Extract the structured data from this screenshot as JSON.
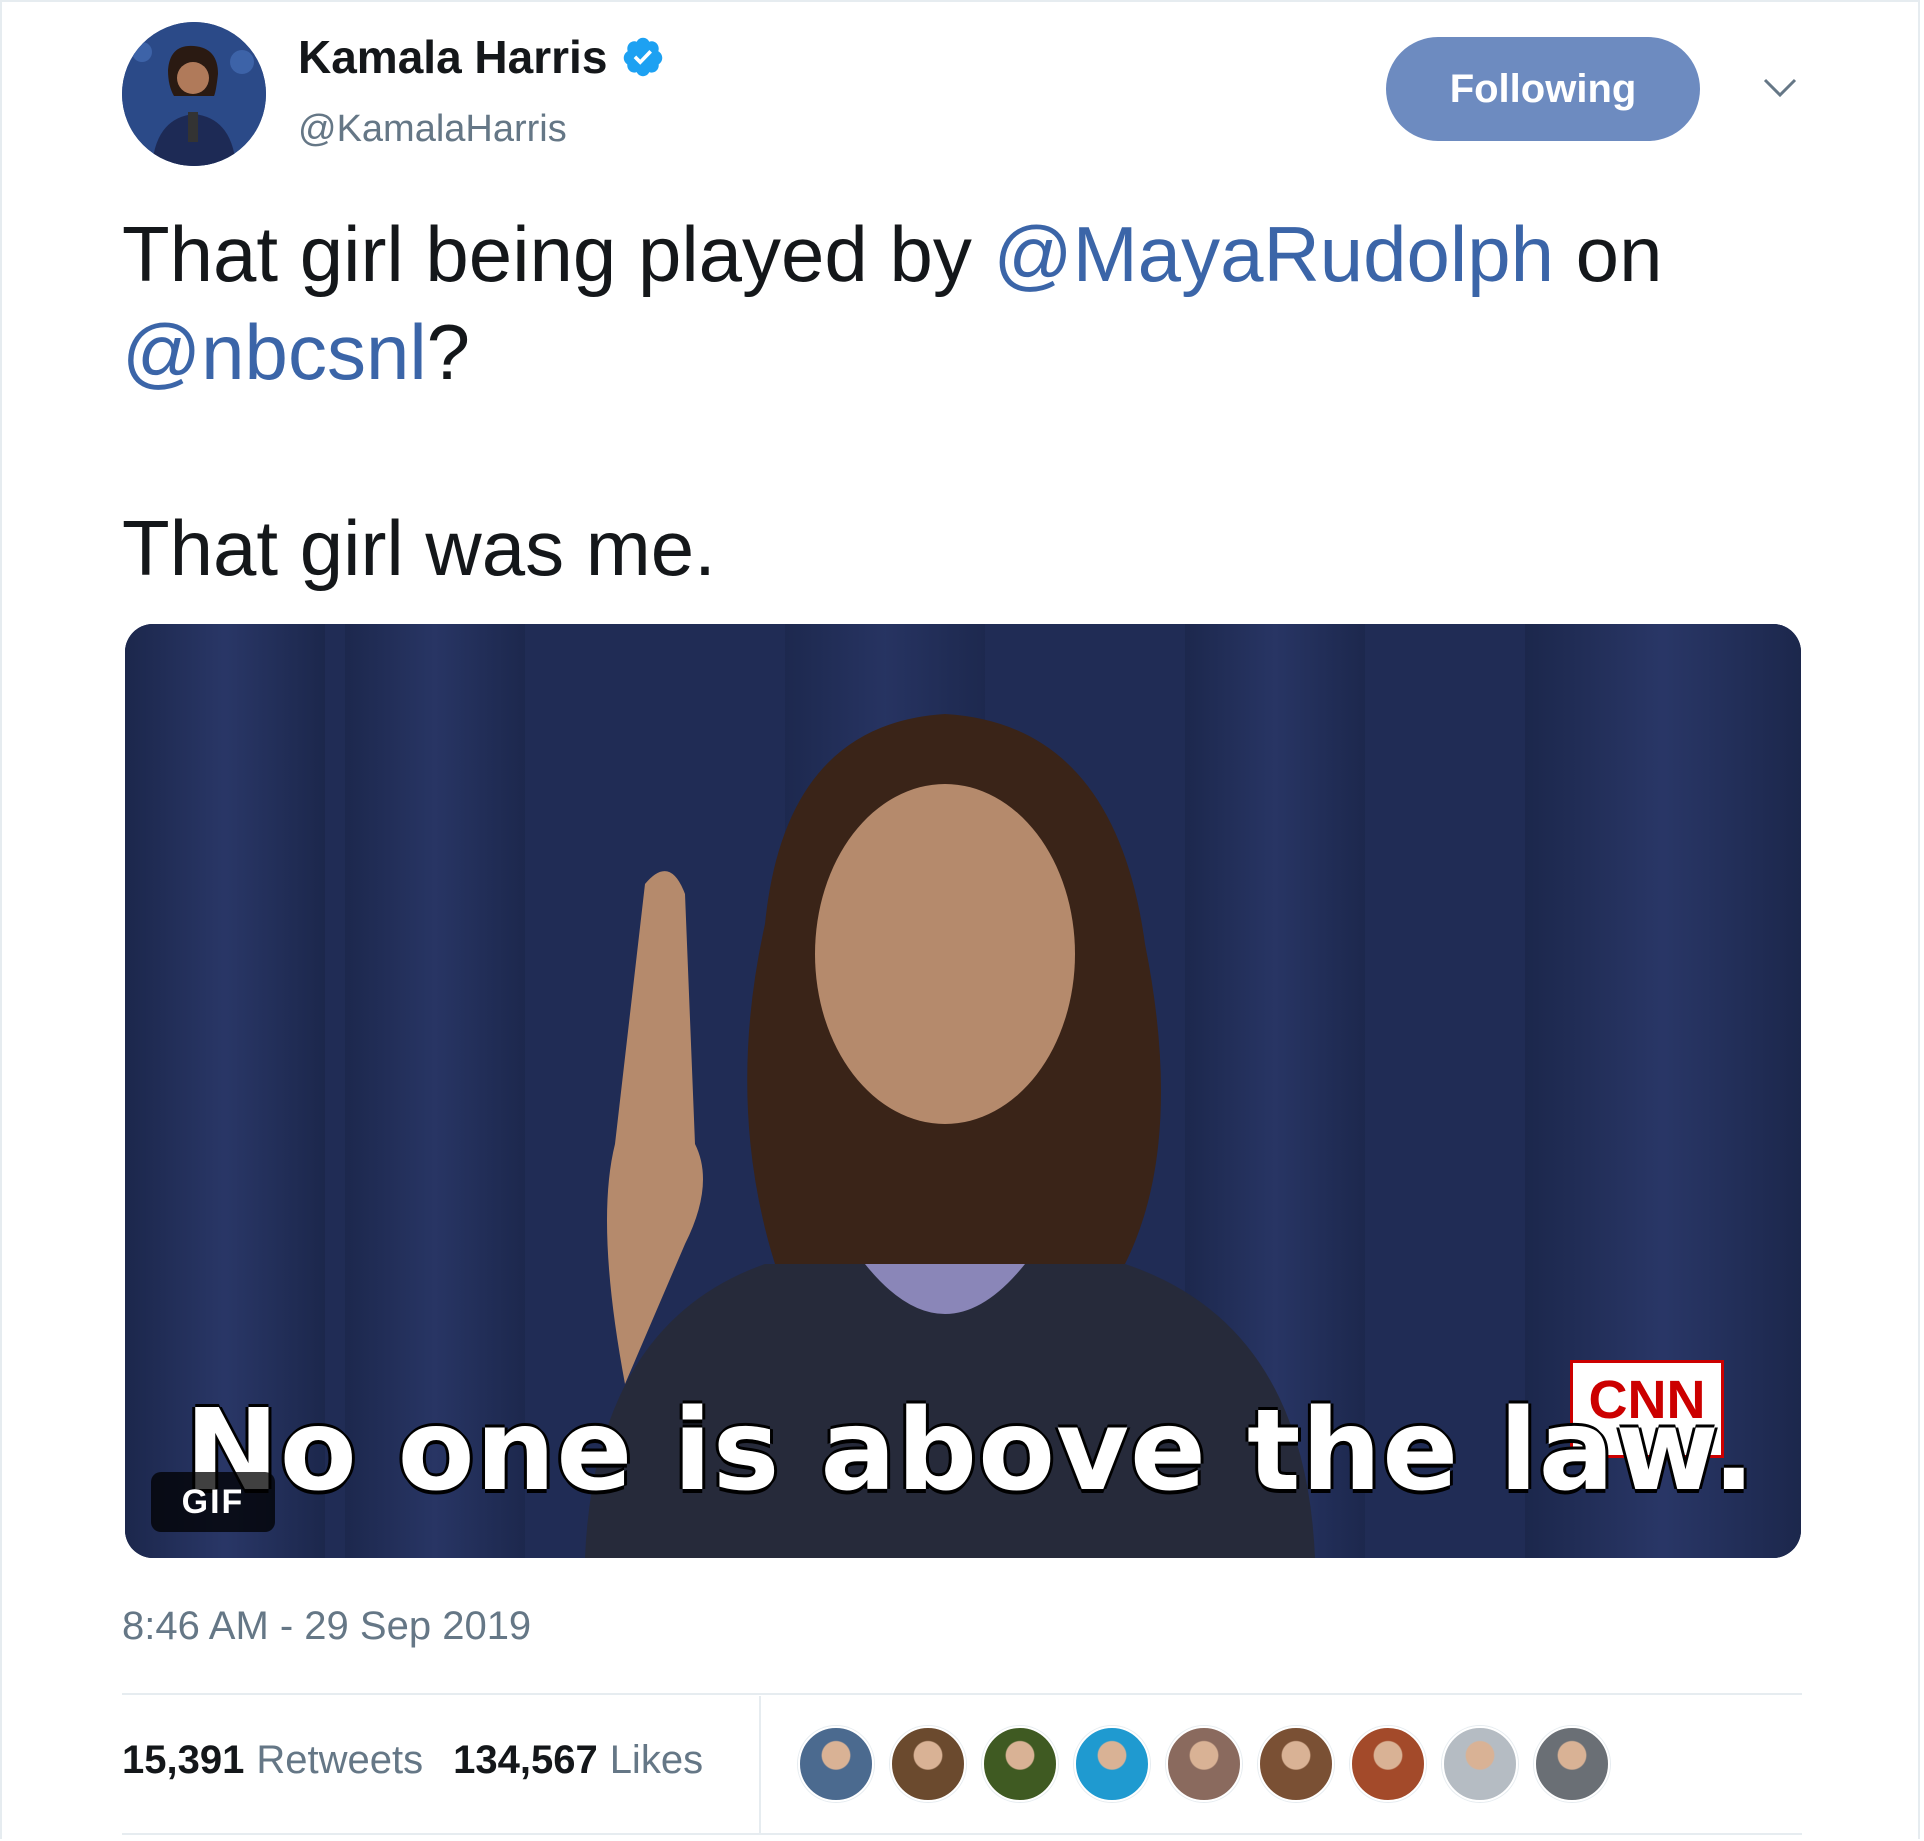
{
  "user": {
    "name": "Kamala Harris",
    "handle": "@KamalaHarris",
    "verified_icon": "verified-badge-icon",
    "follow_label": "Following",
    "menu_icon": "chevron-down-icon"
  },
  "tweet": {
    "line1_prefix": "That girl being played by ",
    "mention1": "@MayaRudolph",
    "line1_suffix": " on",
    "mention2": "@nbcsnl",
    "line2_suffix": "?",
    "line3": "That girl was me."
  },
  "media": {
    "caption": "No one is above the law.",
    "badge": "GIF",
    "logo": "CNN"
  },
  "timestamp": "8:46 AM - 29 Sep 2019",
  "stats": {
    "retweets_count": "15,391",
    "retweets_label": "Retweets",
    "likes_count": "134,567",
    "likes_label": "Likes"
  },
  "likers": [
    {
      "color": "#4b6a8f"
    },
    {
      "color": "#6b4a2e"
    },
    {
      "color": "#3f5a22"
    },
    {
      "color": "#1f9ad0"
    },
    {
      "color": "#8a6a5e"
    },
    {
      "color": "#7a5034"
    },
    {
      "color": "#a34a2a"
    },
    {
      "color": "#b5bcc3"
    },
    {
      "color": "#6a6f75"
    }
  ],
  "colors": {
    "accent": "#3b65a8",
    "button": "#6d8bc0",
    "muted": "#657786"
  }
}
